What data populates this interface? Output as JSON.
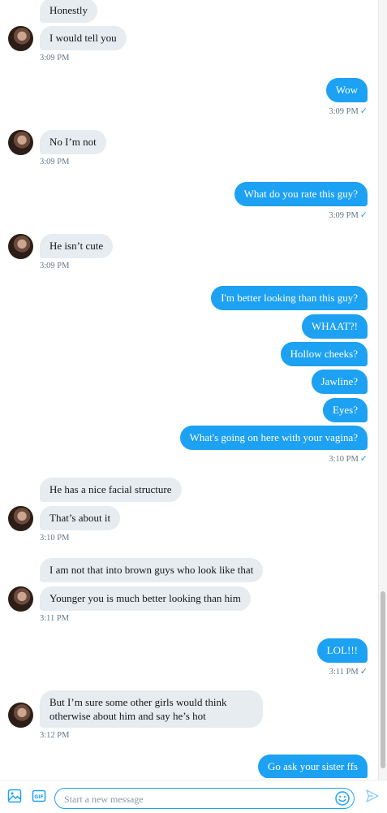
{
  "messages": [
    {
      "text": "Honestly"
    },
    {
      "text": "I would tell you"
    },
    {
      "text": "Wow"
    },
    {
      "text": "No I’m not"
    },
    {
      "text": "What do you rate this guy?"
    },
    {
      "text": "He isn’t cute"
    },
    {
      "text": "I'm better looking than this guy?"
    },
    {
      "text": "WHAAT?!"
    },
    {
      "text": "Hollow cheeks?"
    },
    {
      "text": "Jawline?"
    },
    {
      "text": "Eyes?"
    },
    {
      "text": "What's going on here with your vagina?"
    },
    {
      "text": "He has a nice facial structure"
    },
    {
      "text": "That’s about it"
    },
    {
      "text": "I am not that into brown guys who look like that"
    },
    {
      "text": "Younger you is much better looking than him"
    },
    {
      "text": "LOL!!!"
    },
    {
      "text": "But I’m sure some other girls would think otherwise about him and say he’s hot"
    },
    {
      "text": "Go ask your sister ffs"
    }
  ],
  "timestamps": [
    "3:09 PM",
    "3:09 PM",
    "3:09 PM",
    "3:09 PM",
    "3:09 PM",
    "3:10 PM",
    "3:10 PM",
    "3:11 PM",
    "3:11 PM",
    "3:12 PM"
  ],
  "status": {
    "read_check": "✓"
  },
  "composer": {
    "placeholder": "Start a new message"
  },
  "colors": {
    "accent": "#1da1f2",
    "incoming": "#e6ecf0",
    "timestamp": "#657786"
  },
  "icons": {
    "media": "image-icon",
    "gif": "gif-icon",
    "emoji": "emoji-icon",
    "send": "send-icon"
  }
}
